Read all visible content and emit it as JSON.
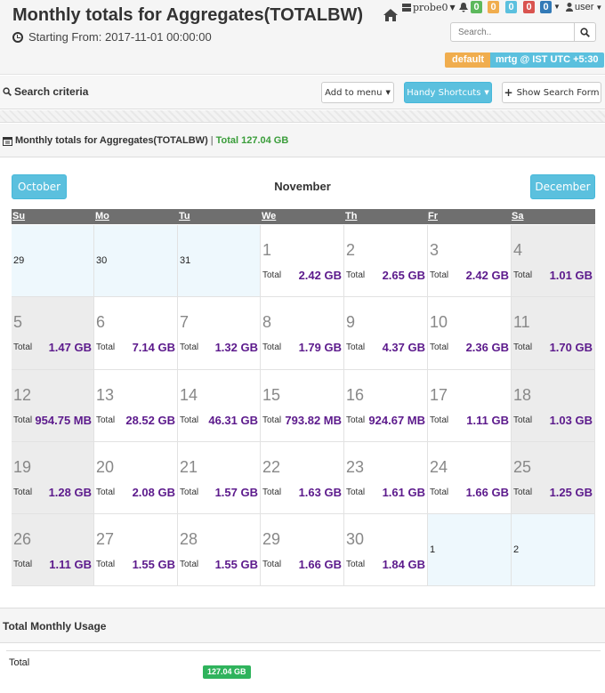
{
  "header": {
    "title": "Monthly totals for Aggregates(TOTALBW)",
    "starting_from": "Starting From: 2017-11-01 00:00:00",
    "probe": "probe0",
    "user": "user",
    "alert_counts": [
      "0",
      "0",
      "0",
      "0",
      "0"
    ],
    "search_placeholder": "Search..",
    "label_default": "default",
    "label_timezone": "mrtg @ IST UTC +5:30"
  },
  "criteria": {
    "title": "Search criteria",
    "add_to_menu": "Add to menu",
    "handy_shortcuts": "Handy Shortcuts",
    "show_search_form": "Show Search Form"
  },
  "panel": {
    "title": "Monthly totals for Aggregates(TOTALBW)",
    "separator": "|",
    "total": "Total 127.04 GB"
  },
  "calendar": {
    "month": "November",
    "prev": "October",
    "next": "December",
    "weekdays": [
      "Su",
      "Mo",
      "Tu",
      "We",
      "Th",
      "Fr",
      "Sa"
    ],
    "total_label": "Total",
    "leading_days": [
      "29",
      "30",
      "31"
    ],
    "trailing_days": [
      "1",
      "2"
    ],
    "days": [
      {
        "day": "1",
        "value": "2.42 GB"
      },
      {
        "day": "2",
        "value": "2.65 GB"
      },
      {
        "day": "3",
        "value": "2.42 GB"
      },
      {
        "day": "4",
        "value": "1.01 GB"
      },
      {
        "day": "5",
        "value": "1.47 GB"
      },
      {
        "day": "6",
        "value": "7.14 GB"
      },
      {
        "day": "7",
        "value": "1.32 GB"
      },
      {
        "day": "8",
        "value": "1.79 GB"
      },
      {
        "day": "9",
        "value": "4.37 GB"
      },
      {
        "day": "10",
        "value": "2.36 GB"
      },
      {
        "day": "11",
        "value": "1.70 GB"
      },
      {
        "day": "12",
        "value": "954.75 MB"
      },
      {
        "day": "13",
        "value": "28.52 GB"
      },
      {
        "day": "14",
        "value": "46.31 GB"
      },
      {
        "day": "15",
        "value": "793.82 MB"
      },
      {
        "day": "16",
        "value": "924.67 MB"
      },
      {
        "day": "17",
        "value": "1.11 GB"
      },
      {
        "day": "18",
        "value": "1.03 GB"
      },
      {
        "day": "19",
        "value": "1.28 GB"
      },
      {
        "day": "20",
        "value": "2.08 GB"
      },
      {
        "day": "21",
        "value": "1.57 GB"
      },
      {
        "day": "22",
        "value": "1.63 GB"
      },
      {
        "day": "23",
        "value": "1.61 GB"
      },
      {
        "day": "24",
        "value": "1.66 GB"
      },
      {
        "day": "25",
        "value": "1.25 GB"
      },
      {
        "day": "26",
        "value": "1.11 GB"
      },
      {
        "day": "27",
        "value": "1.55 GB"
      },
      {
        "day": "28",
        "value": "1.55 GB"
      },
      {
        "day": "29",
        "value": "1.66 GB"
      },
      {
        "day": "30",
        "value": "1.84 GB"
      }
    ]
  },
  "usage": {
    "title": "Total Monthly Usage",
    "label": "Total",
    "value": "127.04 GB"
  },
  "colors": {
    "badge_green": "#5cb85c",
    "badge_orange": "#f0ad4e",
    "badge_blue": "#5bc0de",
    "badge_red": "#d9534f",
    "badge_navy": "#337ab7",
    "value_purple": "#5c1a8c"
  },
  "icons": [
    "home-icon",
    "bell-icon",
    "user-icon",
    "search-icon",
    "clock-icon",
    "calendar-icon",
    "plus-icon"
  ]
}
